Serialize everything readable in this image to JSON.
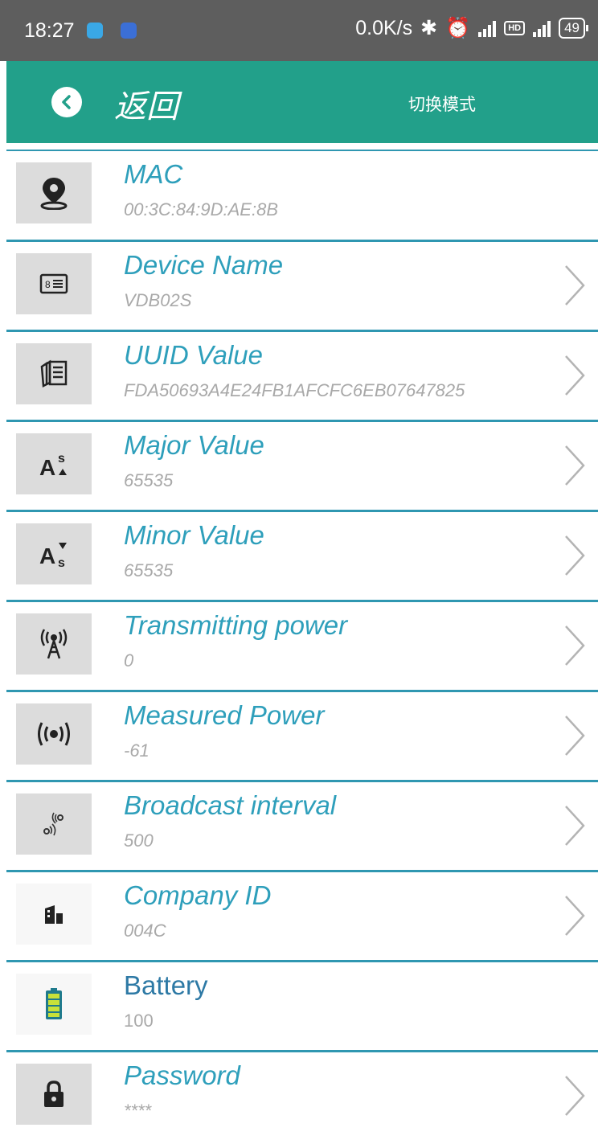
{
  "status_bar": {
    "time": "18:27",
    "network_speed": "0.0K/s",
    "battery_level": "49"
  },
  "header": {
    "back_label": "返回",
    "switch_mode_label": "切换模式",
    "color": "#22a08a"
  },
  "items": [
    {
      "title": "MAC",
      "value": "00:3C:84:9D:AE:8B",
      "icon": "location-pin-icon",
      "has_arrow": false
    },
    {
      "title": "Device Name",
      "value": "VDB02S",
      "icon": "id-card-icon",
      "has_arrow": true
    },
    {
      "title": "UUID Value",
      "value": "FDA50693A4E24FB1AFCFC6EB07647825",
      "icon": "documents-icon",
      "has_arrow": true
    },
    {
      "title": "Major Value",
      "value": "65535",
      "icon": "font-size-up-icon",
      "has_arrow": true
    },
    {
      "title": "Minor Value",
      "value": "65535",
      "icon": "font-size-down-icon",
      "has_arrow": true
    },
    {
      "title": "Transmitting power",
      "value": "0",
      "icon": "antenna-tower-icon",
      "has_arrow": true
    },
    {
      "title": "Measured Power",
      "value": "-61",
      "icon": "broadcast-icon",
      "has_arrow": true
    },
    {
      "title": "Broadcast interval",
      "value": "500",
      "icon": "signal-waves-icon",
      "has_arrow": true
    },
    {
      "title": "Company ID",
      "value": "004C",
      "icon": "building-icon",
      "has_arrow": true
    },
    {
      "title": "Battery",
      "value": "100",
      "icon": "battery-icon",
      "has_arrow": false
    },
    {
      "title": "Password",
      "value": "****",
      "icon": "lock-icon",
      "has_arrow": true
    }
  ]
}
